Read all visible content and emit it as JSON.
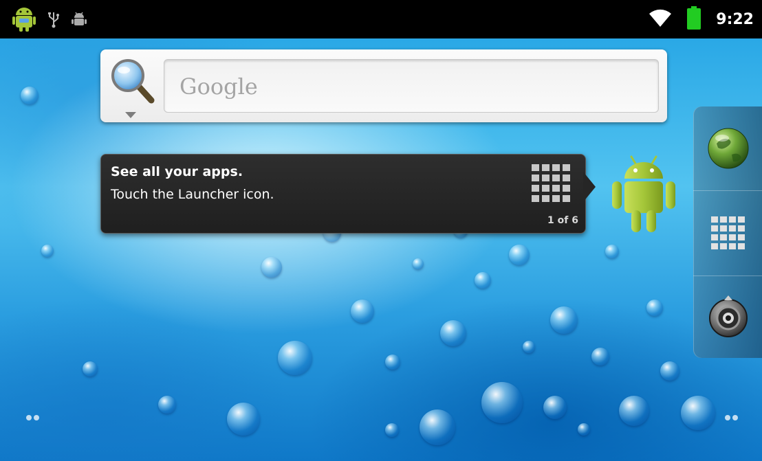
{
  "status_bar": {
    "clock": "9:22",
    "left_icons": [
      "android-notification-icon",
      "usb-icon",
      "debug-icon"
    ],
    "right_icons": [
      "wifi-icon",
      "battery-icon"
    ]
  },
  "search": {
    "placeholder": "Google"
  },
  "tooltip": {
    "title": "See all your apps.",
    "body": "Touch the Launcher icon.",
    "page_indicator": "1 of 6"
  },
  "dock": {
    "items": [
      "browser-globe-icon",
      "launcher-grid-icon",
      "camera-icon"
    ]
  },
  "colors": {
    "status_bar": "#000000",
    "tooltip_bg": "#262626",
    "android_green": "#a4c639",
    "battery_green": "#22cc22"
  }
}
